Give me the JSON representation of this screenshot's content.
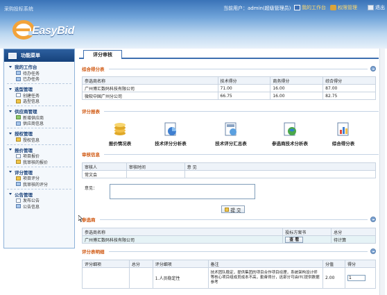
{
  "header": {
    "system_title": "采购投标系统",
    "current_user_label": "当前用户：",
    "current_user": "admin",
    "role": "(超级管理员)",
    "links": {
      "workbench": "我的工作台",
      "permission": "权限管理",
      "exit": "退出"
    },
    "logo_text": "EasyBid"
  },
  "sidebar": {
    "title": "功能菜单",
    "groups": [
      {
        "title": "我的工作台",
        "items": [
          "待办任务",
          "已办任务"
        ]
      },
      {
        "title": "选型管理",
        "items": [
          "创建任务",
          "选型信息"
        ]
      },
      {
        "title": "供应商管理",
        "items": [
          "新增供应商",
          "供应商信息"
        ]
      },
      {
        "title": "授权管理",
        "items": [
          "授权信息"
        ]
      },
      {
        "title": "报价管理",
        "items": [
          "项目报价",
          "我审核的报价"
        ]
      },
      {
        "title": "评分管理",
        "items": [
          "项目评分",
          "我审核的评分"
        ]
      },
      {
        "title": "公告管理",
        "items": [
          "发布公告",
          "公告信息"
        ]
      }
    ]
  },
  "main": {
    "tab": "评分审核",
    "summary": {
      "title": "综合得分表",
      "headers": [
        "参选商名称",
        "技术得分",
        "商务得分",
        "综合得分"
      ],
      "rows": [
        [
          "广州博汇数码科技有限公司",
          "71.00",
          "16.00",
          "87.00"
        ],
        [
          "微软中国广州分公司",
          "66.75",
          "16.00",
          "82.75"
        ]
      ]
    },
    "reports": {
      "title": "评分报表",
      "items": [
        "报价情况表",
        "技术评分分析表",
        "技术评分汇总表",
        "参选商技术分析表",
        "综合得分表"
      ]
    },
    "audit": {
      "title": "审核信息",
      "headers": [
        "审核人",
        "审核时间",
        "意 见"
      ],
      "rows": [
        [
          "常文会",
          "",
          ""
        ]
      ],
      "opinion_label": "意见：",
      "opinion_value": "",
      "submit": "提 交"
    },
    "vendors": {
      "title": "参选商",
      "headers": [
        "参选商名称",
        "投标方案书",
        "总分"
      ],
      "rows": [
        [
          "广州博汇数码科技有限公司",
          "查 看",
          "待计算"
        ]
      ]
    },
    "details": {
      "title": "评分表明细",
      "headers": [
        "评分细项",
        "总分",
        "评分细项",
        "备注",
        "分值",
        "得分"
      ],
      "rows": [
        [
          "",
          "",
          "1.人员稳定性",
          "技术团队稳定，提供集团的项目合作项目经理，系统架构设计师等核心项目组成员成本不高，勤奋得分，这部分可由ITC提供数据参考",
          "2.00",
          "1"
        ]
      ]
    },
    "colors": {
      "section_title": "#d05a14",
      "accent": "#3d6fb0"
    }
  }
}
